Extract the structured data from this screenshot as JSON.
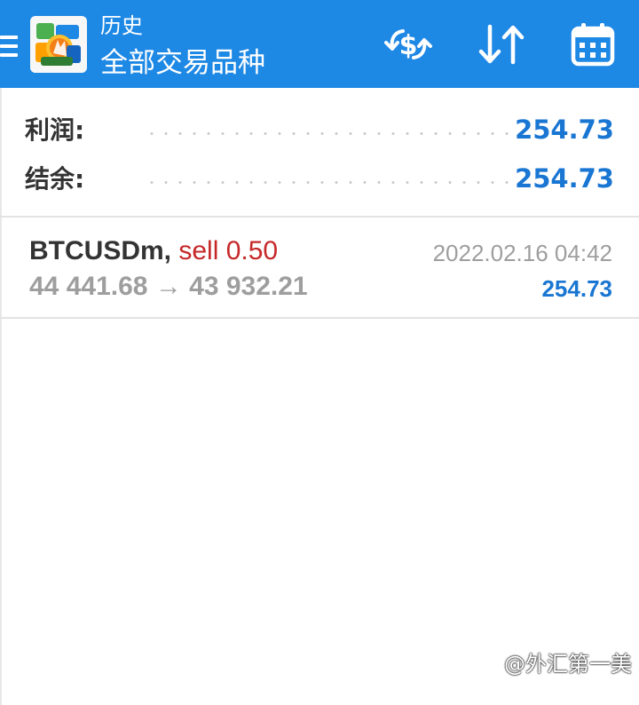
{
  "header": {
    "title_small": "历史",
    "title_large": "全部交易品种",
    "menu_icon": "menu-icon",
    "app_icon": "metatrader-logo-icon",
    "actions": [
      {
        "name": "currency-exchange-icon"
      },
      {
        "name": "sort-icon"
      },
      {
        "name": "calendar-icon"
      }
    ],
    "bar_color": "#1e88e5"
  },
  "summary": {
    "profit_label": "利润:",
    "profit_value": "254.73",
    "balance_label": "结余:",
    "balance_value": "254.73",
    "value_color": "#1976d2"
  },
  "trades": [
    {
      "symbol": "BTCUSDm,",
      "action": "sell 0.50",
      "open_price": "44 441.68",
      "arrow": "→",
      "close_price": "43 932.21",
      "time": "2022.02.16 04:42",
      "profit": "254.73",
      "action_color": "#c62828"
    }
  ],
  "watermark": {
    "text": "@外汇第一美"
  }
}
